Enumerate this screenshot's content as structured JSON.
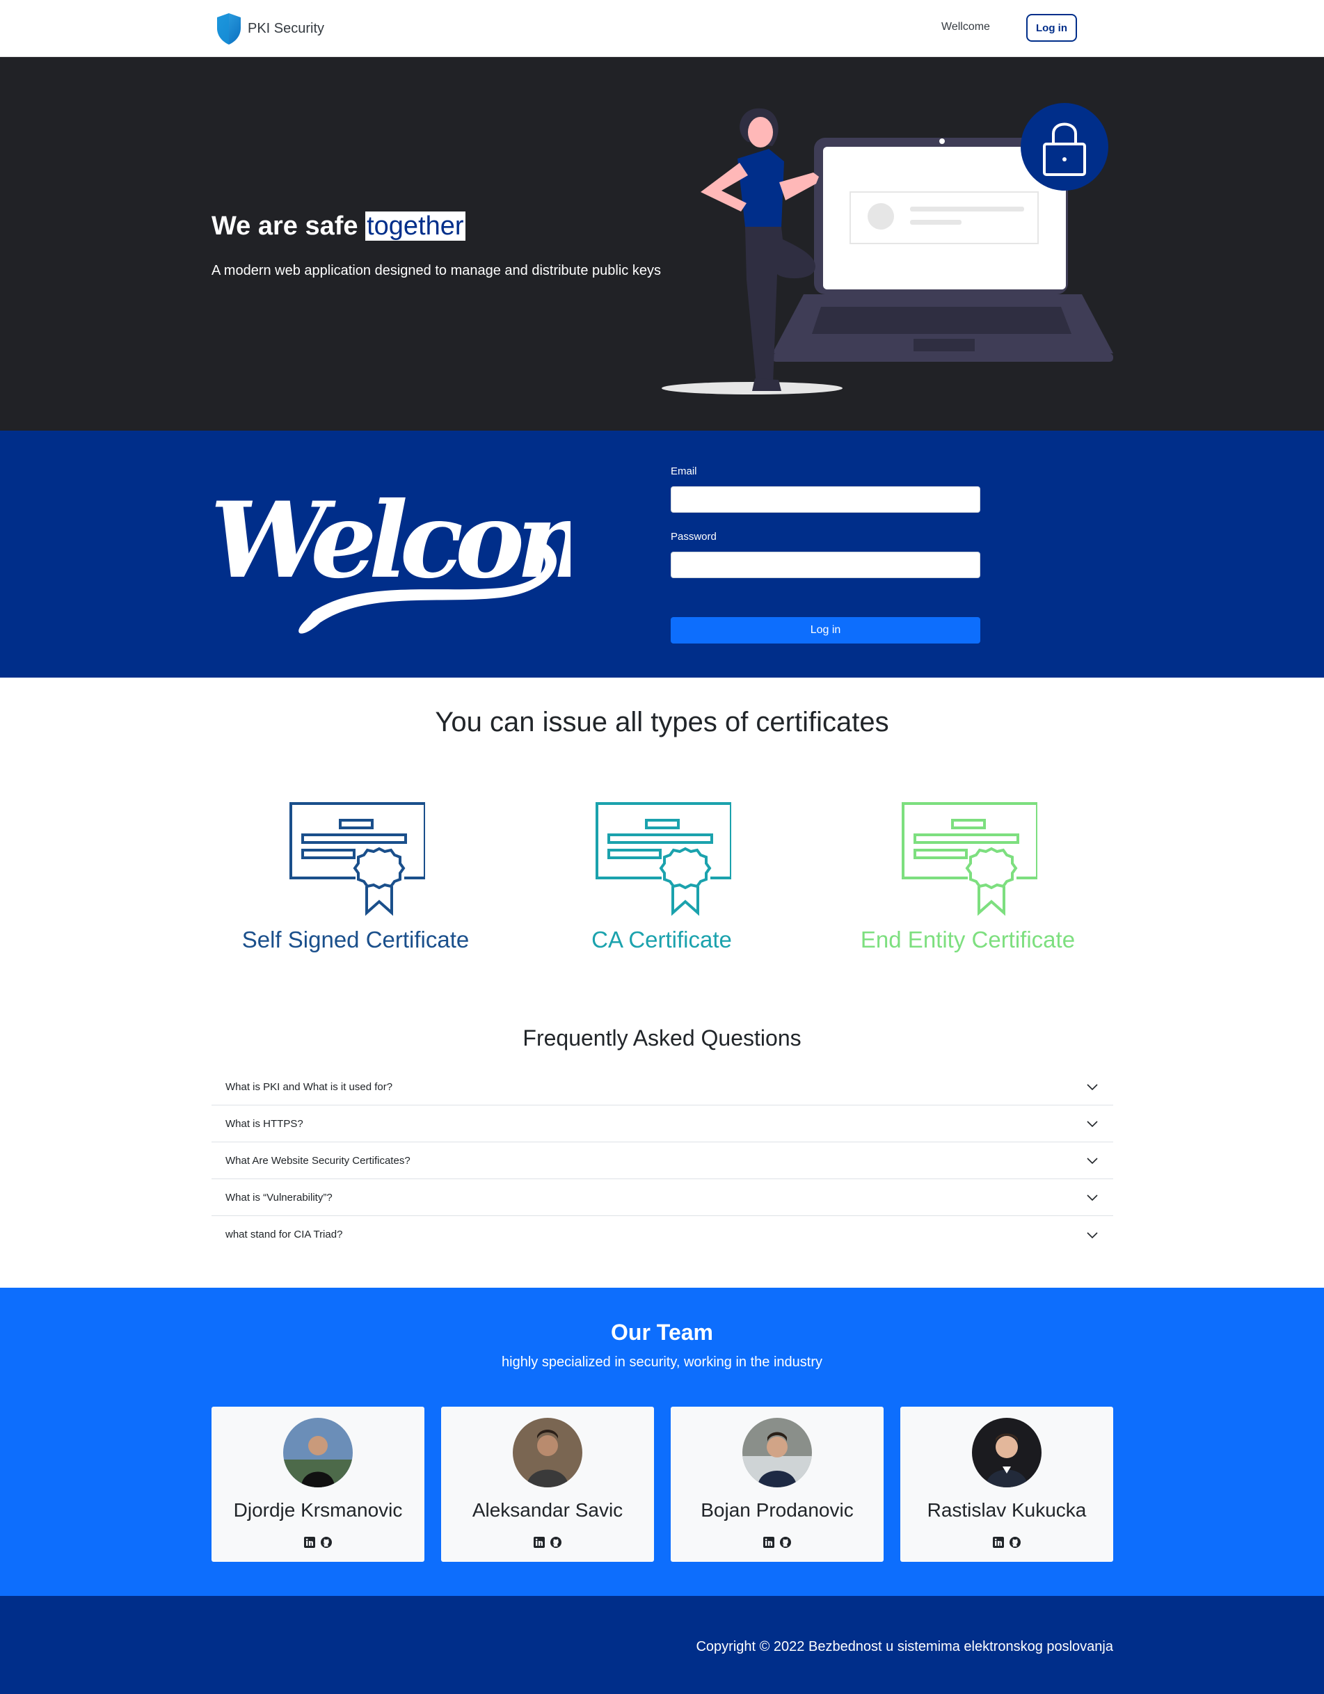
{
  "navbar": {
    "brand": "PKI Security",
    "link": "Wellcome",
    "login_label": "Log in"
  },
  "hero": {
    "title_prefix": "We are safe ",
    "title_highlight": "together",
    "subtitle": "A modern web application designed to manage and distribute public keys"
  },
  "welcome": {
    "script_text": "Welcome",
    "email_label": "Email",
    "email_value": "",
    "password_label": "Password",
    "password_value": "",
    "submit_label": "Log in"
  },
  "certificates": {
    "heading": "You can issue all types of certificates",
    "items": [
      {
        "label": "Self Signed Certificate",
        "color": "#1a4f8b",
        "icon": "certificate-icon"
      },
      {
        "label": "CA Certificate",
        "color": "#1ba2ad",
        "icon": "certificate-icon"
      },
      {
        "label": "End Entity Certificate",
        "color": "#7ddf7f",
        "icon": "certificate-icon"
      }
    ]
  },
  "faq": {
    "heading": "Frequently Asked Questions",
    "items": [
      {
        "question": "What is PKI and What is it used for?"
      },
      {
        "question": "What is HTTPS?"
      },
      {
        "question": "What Are Website Security Certificates?"
      },
      {
        "question": "What is “Vulnerability”?"
      },
      {
        "question": "what stand for CIA Triad?"
      }
    ]
  },
  "team": {
    "title": "Our Team",
    "subtitle": "highly specialized in security, working in the industry",
    "members": [
      {
        "name": "Djordje Krsmanovic"
      },
      {
        "name": "Aleksandar Savic"
      },
      {
        "name": "Bojan Prodanovic"
      },
      {
        "name": "Rastislav Kukucka"
      }
    ]
  },
  "footer": {
    "copyright": "Copyright © 2022 Bezbednost u sistemima elektronskog poslovanja"
  },
  "colors": {
    "navy": "#002e8a",
    "primary": "#0d6efd",
    "dark": "#212226"
  }
}
